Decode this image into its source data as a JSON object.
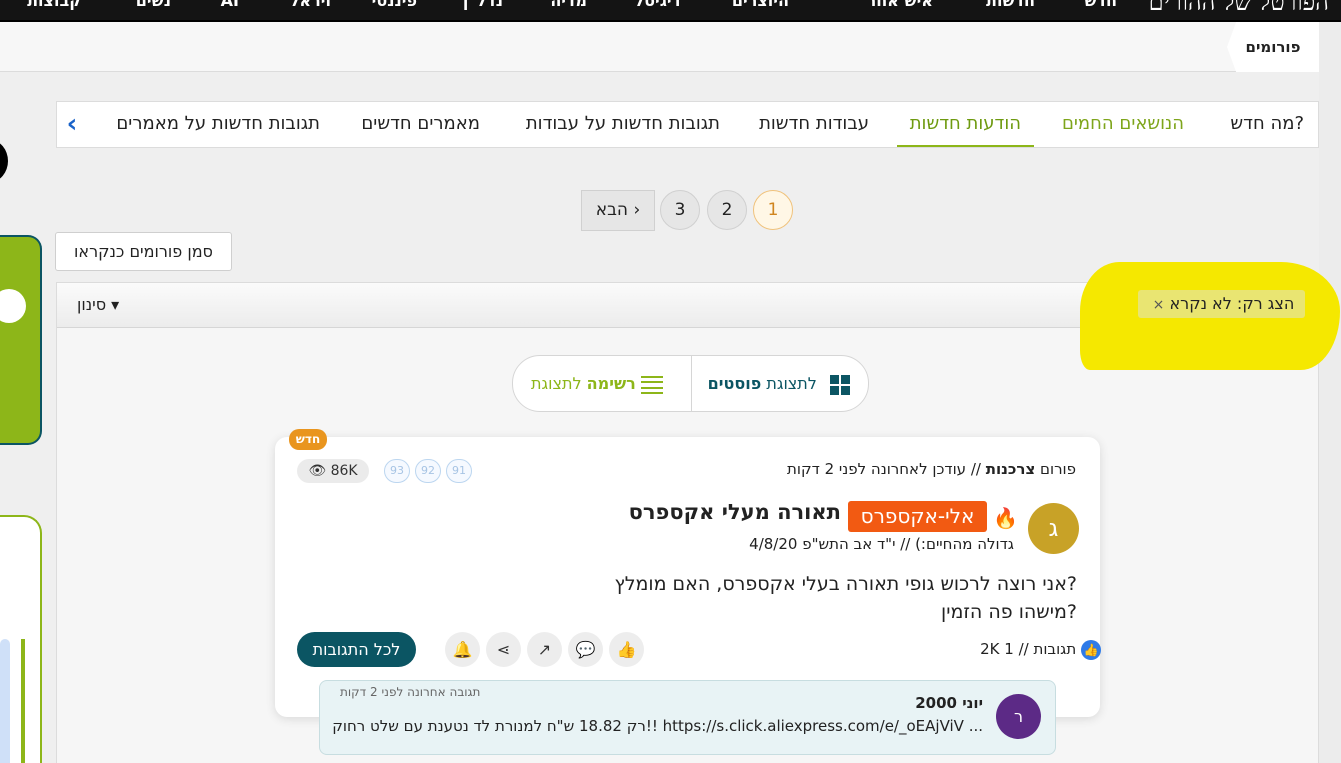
{
  "topnav": {
    "brand": "הפורטל של ההורים",
    "items": [
      "קבוצות",
      "נשים",
      "AI",
      "ויראל",
      "פיננסי",
      "נדל\"ן",
      "מדיה",
      "דיגיטל",
      "היוצרים",
      "איש אחר",
      "חדשות",
      "חדש"
    ]
  },
  "breadcrumb": {
    "label": "פורומים"
  },
  "tabs": {
    "items": [
      "מה חדש?",
      "הנושאים החמים",
      "הודעות חדשות",
      "עבודות חדשות",
      "תגובות חדשות על עבודות",
      "מאמרים חדשים",
      "תגובות חדשות על מאמרים"
    ]
  },
  "pagination": {
    "pages": [
      "1",
      "2",
      "3"
    ],
    "next": "הבא ›",
    "current": "1"
  },
  "mark_read_button": "סמן פורומים כנקראו",
  "filter": {
    "label": "סינון ▾",
    "active_chip": "הצג רק: לא נקרא",
    "chip_close": "×"
  },
  "view_toggle": {
    "posts_prefix": "לתצוגת",
    "posts_bold": "פוסטים",
    "list_prefix": "לתצוגת",
    "list_bold": "רשימה"
  },
  "post": {
    "new_badge": "חדש",
    "forum_prefix": "פורום",
    "forum_name": "צרכנות",
    "updated": "// עודכן לאחרונה לפני 2 דקות",
    "views": "86K",
    "mini_counts": [
      "93",
      "92",
      "91"
    ],
    "avatar_letter": "ג",
    "tag": "אלי-אקספרס",
    "title": "תאורה מעלי אקספרס",
    "meta": "גדולה מהחיים:) // י\"ד אב התש\"פ 4/8/20",
    "body_line1": "אני רוצה לרכוש גופי תאורה בעלי אקספרס, האם מומלץ?",
    "body_line2": "מישהו פה הזמין?",
    "likes": "1",
    "replies": "2K תגובות",
    "like_sep": "//",
    "all_replies_button": "לכל התגובות"
  },
  "reply": {
    "avatar_letter": "ר",
    "name": "יוני 2000",
    "time": "תגובה אחרונה לפני 2 דקות",
    "text": "רק 18.82 ש\"ח למנורת לד נטענת עם שלט רחוק!! https://s.click.aliexpress.com/e/_oEAjViV ..."
  },
  "colors": {
    "accent_green": "#8db619",
    "teal": "#0b5563",
    "orange": "#f25a12",
    "highlight": "#f5e800"
  }
}
